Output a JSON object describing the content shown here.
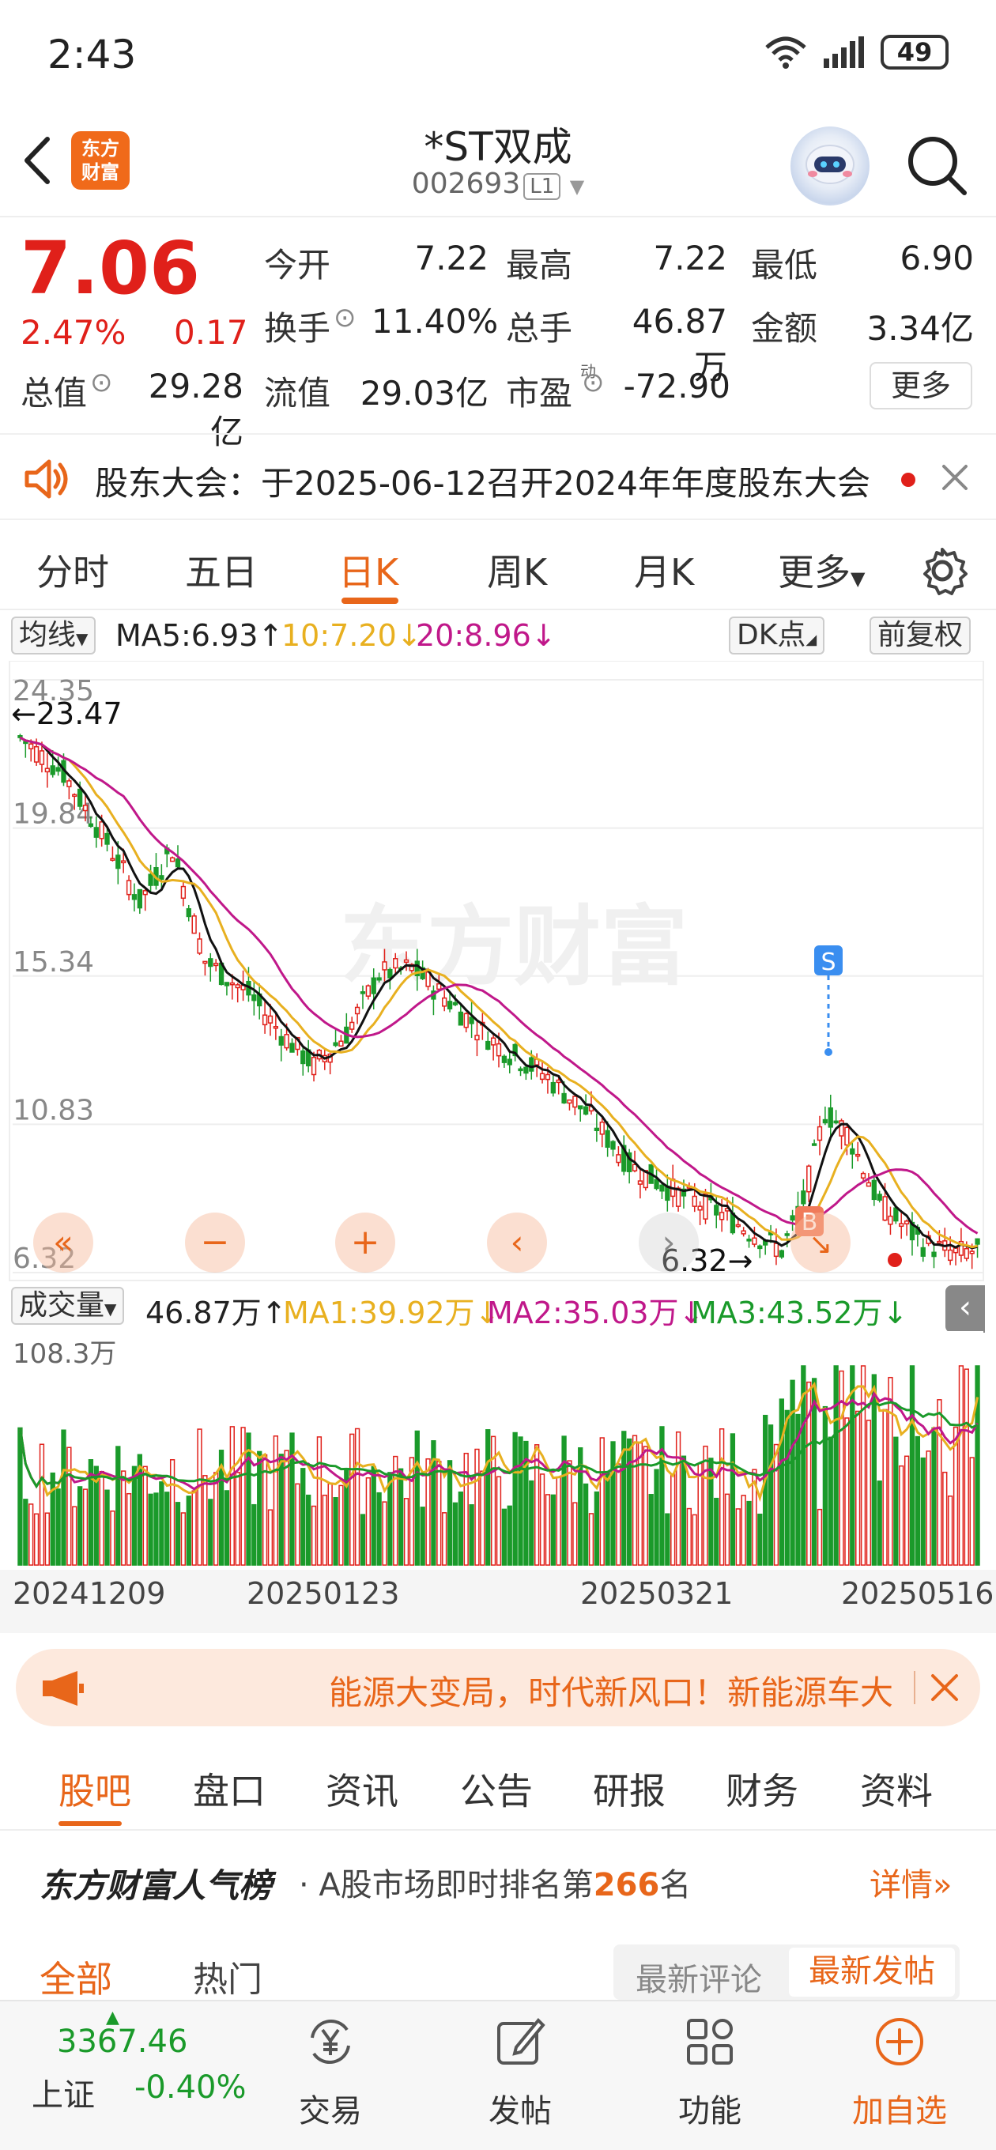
{
  "status_bar": {
    "time": "2:43",
    "battery": "49"
  },
  "header": {
    "logo_line1": "东方",
    "logo_line2": "财富",
    "stock_name": "*ST双成",
    "stock_code": "002693",
    "level_badge": "L1"
  },
  "quote": {
    "price": "7.06",
    "change_pct": "2.47%",
    "change_abs": "0.17",
    "fields": {
      "open_label": "今开",
      "open": "7.22",
      "high_label": "最高",
      "high": "7.22",
      "low_label": "最低",
      "low": "6.90",
      "turnover_label": "换手",
      "turnover": "11.40%",
      "volume_label": "总手",
      "volume": "46.87万",
      "amount_label": "金额",
      "amount": "3.34亿",
      "total_cap_label": "总值",
      "total_cap": "29.28亿",
      "float_cap_label": "流值",
      "float_cap": "29.03亿",
      "pe_label": "市盈",
      "pe_sup": "动",
      "pe": "-72.90"
    },
    "more_label": "更多"
  },
  "notice": {
    "text": "股东大会：于2025-06-12召开2024年年度股东大会"
  },
  "period_tabs": [
    "分时",
    "五日",
    "日K",
    "周K",
    "月K",
    "更多"
  ],
  "period_active": 2,
  "kline": {
    "ma_selector": "均线",
    "ma5": "MA5:6.93",
    "ma10": "10:7.20",
    "ma20": "20:8.96",
    "dk_label": "DK点",
    "adjust_label": "前复权",
    "high_mark": "←23.47",
    "low_mark": "6.32→",
    "marker_s": "S",
    "marker_b": "B",
    "watermark": "东方财富",
    "colors": {
      "up": "#e0201a",
      "down": "#1a9a2a",
      "ma5": "#111111",
      "ma10": "#e8b020",
      "ma20": "#c0188a"
    }
  },
  "volume": {
    "selector": "成交量",
    "vol": "46.87万",
    "ma1": "MA1:39.92万",
    "ma2": "MA2:35.03万",
    "ma3": "MA3:43.52万",
    "max_label": "108.3万"
  },
  "date_axis": [
    "20241209",
    "20250123",
    "20250321",
    "20250516"
  ],
  "chart_data": {
    "type": "candlestick",
    "y_ticks": [
      "24.35",
      "19.84",
      "15.34",
      "10.83",
      "6.32"
    ],
    "ylim": [
      6.32,
      24.35
    ],
    "x_labels": [
      "20241209",
      "20250123",
      "20250321",
      "20250516"
    ],
    "series": [
      {
        "name": "MA5",
        "last": 6.93
      },
      {
        "name": "MA10",
        "last": 7.2
      },
      {
        "name": "MA20",
        "last": 8.96
      }
    ],
    "annotations": [
      "←23.47",
      "6.32→"
    ],
    "volume_max": "108.3万"
  },
  "ad": {
    "text": "能源大变局，时代新风口！新能源车大"
  },
  "section_tabs": [
    "股吧",
    "盘口",
    "资讯",
    "公告",
    "研报",
    "财务",
    "资料"
  ],
  "ranking": {
    "brand": "东方财富人气榜",
    "text_prefix": "· A股市场即时排名第",
    "rank": "266",
    "text_suffix": "名",
    "detail": "详情"
  },
  "filters": {
    "all": "全部",
    "hot": "热门",
    "latest_comment": "最新评论",
    "latest_post": "最新发帖"
  },
  "bottom_bar": {
    "index_value": "3367.46",
    "index_name": "上证",
    "index_change": "-0.40%",
    "trade": "交易",
    "post": "发帖",
    "functions": "功能",
    "add_watch": "加自选"
  }
}
